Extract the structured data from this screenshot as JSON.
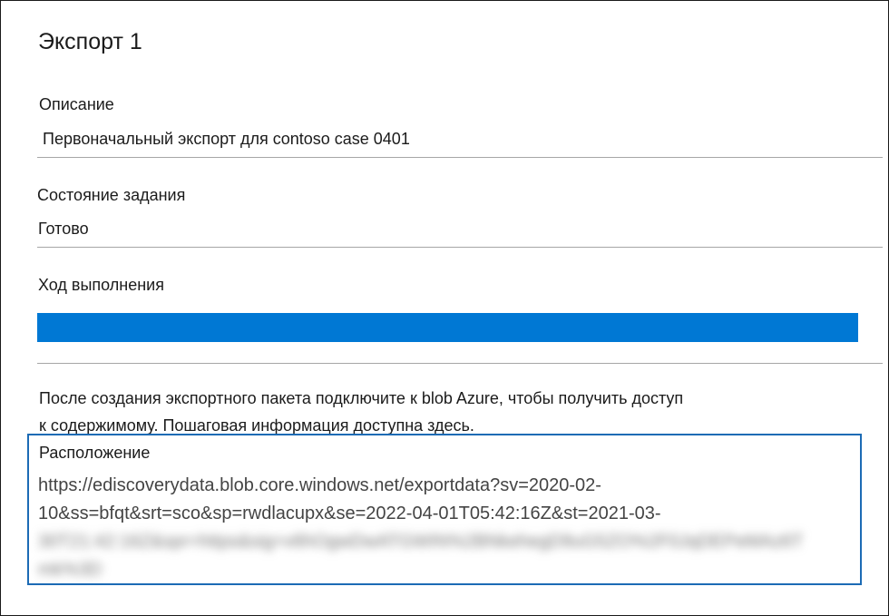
{
  "panel": {
    "title": "Экспорт 1"
  },
  "description": {
    "label": "Описание",
    "value": "Первоначальный экспорт для contoso case 0401"
  },
  "job_status": {
    "label": "Состояние задания",
    "value": "Готово"
  },
  "progress": {
    "label": "Ход выполнения",
    "percent": 100,
    "color": "#0078d4"
  },
  "note": {
    "line1": "После создания экспортного пакета подключите к blob Azure, чтобы получить доступ",
    "line2": "к содержимому. Пошаговая информация доступна здесь."
  },
  "location": {
    "label": "Расположение",
    "url_line1": "https://ediscoverydata.blob.core.windows.net/exportdata?sv=2020-02-",
    "url_line2": "10&ss=bfqt&srt=sco&sp=rwdlacupx&se=2022-04-01T05:42:16Z&st=2021-03-",
    "url_line3_blurred": "30T21:42:16Z&spr=https&sig=v6hOgwDwATGWIN%2BNkehegD9uG5ZO%2F0JqDEPeMAz6T",
    "url_line4_blurred": "mk%3D",
    "border_color": "#1c6bb5"
  }
}
